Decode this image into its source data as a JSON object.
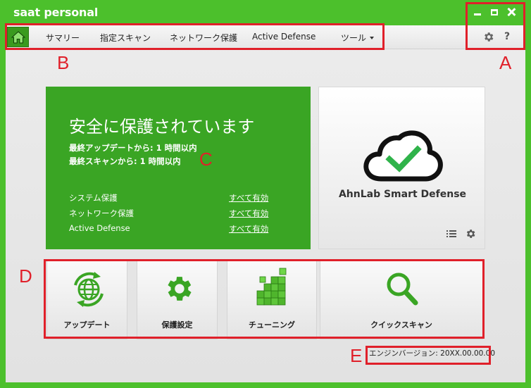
{
  "window": {
    "title": "saat personal"
  },
  "menu": {
    "items": [
      {
        "label": "サマリー"
      },
      {
        "label": "指定スキャン"
      },
      {
        "label": "ネットワーク保護"
      },
      {
        "label": "Active Defense"
      },
      {
        "label": "ツール"
      }
    ],
    "help_label": "?"
  },
  "status": {
    "title": "安全に保護されています",
    "last_update": "最終アップデートから: 1 時間以内",
    "last_scan": "最終スキャンから: 1 時間以内",
    "protections": [
      {
        "label": "システム保護",
        "value": "すべて有効"
      },
      {
        "label": "ネットワーク保護",
        "value": "すべて有効"
      },
      {
        "label": "Active Defense",
        "value": "すべて有効"
      }
    ]
  },
  "smart_defense": {
    "label": "AhnLab Smart Defense"
  },
  "tiles": [
    {
      "label": "アップデート"
    },
    {
      "label": "保護設定"
    },
    {
      "label": "チューニング"
    },
    {
      "label": "クイックスキャン"
    }
  ],
  "engine_version": "エンジンバージョン: 20XX.00.00.00",
  "annotations": {
    "A": "A",
    "B": "B",
    "C": "C",
    "D": "D",
    "E": "E"
  },
  "colors": {
    "brand_green": "#4cc02c",
    "panel_green": "#3aa524",
    "annotation_red": "#e0202a"
  },
  "icons": {
    "home": "home-icon",
    "gear": "gear-icon",
    "help": "help-icon",
    "cloud_check": "cloud-check-icon",
    "list": "list-icon",
    "update": "globe-refresh-icon",
    "settings": "gear-icon",
    "tuning": "cubes-icon",
    "quick_scan": "magnifier-icon"
  }
}
